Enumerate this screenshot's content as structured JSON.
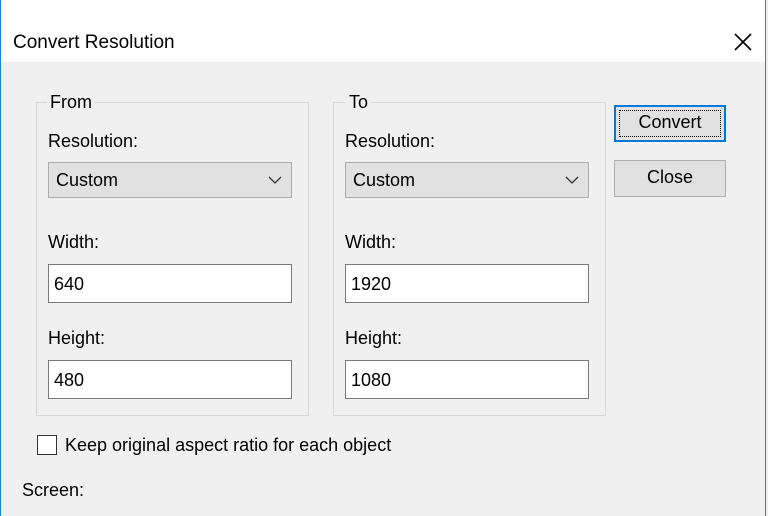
{
  "window": {
    "title": "Convert Resolution",
    "accent_color": "#1883d7",
    "close_icon": "close-icon"
  },
  "from_group": {
    "legend": "From",
    "resolution_label": "Resolution:",
    "resolution_value": "Custom",
    "width_label": "Width:",
    "width_value": "640",
    "height_label": "Height:",
    "height_value": "480"
  },
  "to_group": {
    "legend": "To",
    "resolution_label": "Resolution:",
    "resolution_value": "Custom",
    "width_label": "Width:",
    "width_value": "1920",
    "height_label": "Height:",
    "height_value": "1080"
  },
  "buttons": {
    "convert_label": "Convert",
    "close_label": "Close"
  },
  "options": {
    "keep_aspect_label": "Keep original aspect ratio for each object",
    "keep_aspect_checked": false,
    "screen_label": "Screen:"
  }
}
